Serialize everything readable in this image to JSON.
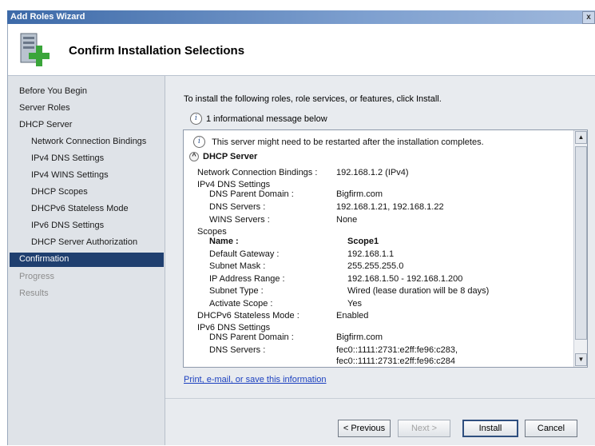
{
  "window": {
    "title": "Add Roles Wizard",
    "close_glyph": "x"
  },
  "header": {
    "title": "Confirm Installation Selections",
    "icon": "server-add-icon"
  },
  "nav": {
    "items": [
      {
        "label": "Before You Begin"
      },
      {
        "label": "Server Roles"
      },
      {
        "label": "DHCP Server"
      },
      {
        "label": "Network Connection Bindings"
      },
      {
        "label": "IPv4 DNS Settings"
      },
      {
        "label": "IPv4 WINS Settings"
      },
      {
        "label": "DHCP Scopes"
      },
      {
        "label": "DHCPv6 Stateless Mode"
      },
      {
        "label": "IPv6 DNS Settings"
      },
      {
        "label": "DHCP Server Authorization"
      },
      {
        "label": "Confirmation"
      },
      {
        "label": "Progress"
      },
      {
        "label": "Results"
      }
    ]
  },
  "main": {
    "intro": "To install the following roles, role services, or features, click Install.",
    "info_count": "1 informational message below",
    "restart_msg": "This server might need to be restarted after the installation completes.",
    "section_title": "DHCP Server",
    "details": {
      "ncb_label": "Network Connection Bindings :",
      "ncb_value": "192.168.1.2 (IPv4)",
      "ipv4dns_head": "IPv4 DNS Settings",
      "dns_parent_label": "DNS Parent Domain :",
      "dns_parent_value": "Bigfirm.com",
      "dns_servers_label": "DNS Servers :",
      "dns_servers_value": "192.168.1.21, 192.168.1.22",
      "wins_label": "WINS Servers :",
      "wins_value": "None",
      "scopes_head": "Scopes",
      "name_label": "Name :",
      "name_value": "Scope1",
      "gw_label": "Default Gateway :",
      "gw_value": "192.168.1.1",
      "mask_label": "Subnet Mask :",
      "mask_value": "255.255.255.0",
      "range_label": "IP Address Range :",
      "range_value": "192.168.1.50 - 192.168.1.200",
      "type_label": "Subnet Type :",
      "type_value": "Wired (lease duration will be 8 days)",
      "activate_label": "Activate Scope :",
      "activate_value": "Yes",
      "v6mode_label": "DHCPv6 Stateless Mode :",
      "v6mode_value": "Enabled",
      "ipv6dns_head": "IPv6 DNS Settings",
      "v6_parent_label": "DNS Parent Domain :",
      "v6_parent_value": "Bigfirm.com",
      "v6_servers_label": "DNS Servers :",
      "v6_servers_value1": "fec0::1111:2731:e2ff:fe96:c283,",
      "v6_servers_value2": "fec0::1111:2731:e2ff:fe96:c284"
    },
    "link": "Print, e-mail, or save this information"
  },
  "buttons": {
    "previous": "< Previous",
    "next": "Next >",
    "install": "Install",
    "cancel": "Cancel"
  },
  "colors": {
    "nav_selected": "#1f3f6f",
    "link": "#1a3fbf",
    "title_bar": "#3d6aa8"
  }
}
